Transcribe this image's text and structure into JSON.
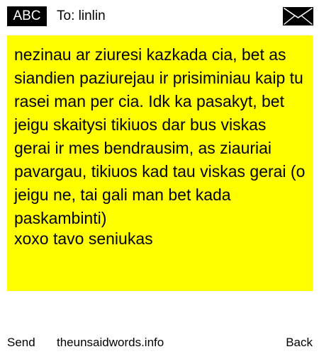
{
  "header": {
    "badge_label": "ABC",
    "to_line": "To: linlin",
    "envelope_icon": "envelope-icon"
  },
  "message": {
    "body": "nezinau ar ziuresi kazkada cia, bet as siandien paziurejau ir prisiminiau kaip tu rasei man per cia. Idk ka pasakyt, bet jeigu skaitysi tikiuos dar bus viskas gerai ir mes bendrausim, as ziauriai pavargau, tikiuos kad tau viskas gerai (o jeigu ne, tai gali man bet kada paskambinti)",
    "signature": "xoxo tavo seniukas",
    "background_color": "#ffff00"
  },
  "footer": {
    "send_label": "Send",
    "site_label": "theunsaidwords.info",
    "back_label": "Back"
  }
}
